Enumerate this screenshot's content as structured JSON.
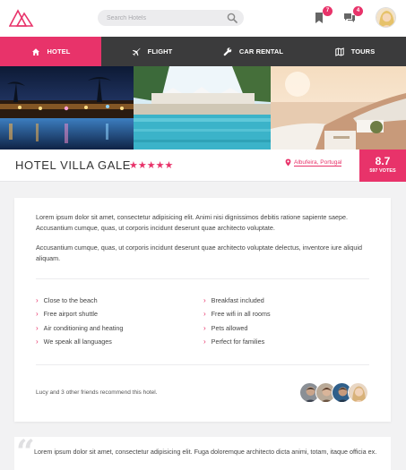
{
  "header": {
    "search_placeholder": "Search Hotels",
    "bookmarks_count": "7",
    "messages_count": "4"
  },
  "nav": {
    "tabs": [
      {
        "label": "HOTEL",
        "icon": "home-icon",
        "active": true
      },
      {
        "label": "FLIGHT",
        "icon": "airplane-icon",
        "active": false
      },
      {
        "label": "CAR RENTAL",
        "icon": "wrench-icon",
        "active": false
      },
      {
        "label": "TOURS",
        "icon": "map-icon",
        "active": false
      }
    ]
  },
  "hotel": {
    "name": "HOTEL VILLA GALE",
    "stars": "★★★★★",
    "rating_stars": 5,
    "location": "Albufeira, Portugal",
    "score": "8.7",
    "votes": "597 VOTES"
  },
  "description": {
    "paragraph1": "Lorem ipsum dolor sit amet, consectetur adipisicing elit. Animi nisi dignissimos debitis ratione sapiente saepe. Accusantium cumque, quas, ut corporis incidunt deserunt quae architecto voluptate.",
    "paragraph2": "Accusantium cumque, quas, ut corporis incidunt deserunt quae architecto voluptate delectus, inventore iure aliquid aliquam."
  },
  "amenities": {
    "left": [
      "Close to the beach",
      "Free airport shuttle",
      "Air conditioning and heating",
      "We speak all languages"
    ],
    "right": [
      "Breakfast included",
      "Free wifi in all rooms",
      "Pets allowed",
      "Perfect for families"
    ]
  },
  "recommendation": {
    "text": "Lucy and 3 other friends recommend this hotel."
  },
  "review": {
    "quote_mark": "“",
    "text": "Lorem ipsum dolor sit amet, consectetur adipisicing elit. Fuga doloremque architecto dicta animi, totam, itaque officia ex."
  },
  "colors": {
    "accent": "#e8336a",
    "nav_bg": "#3b3b3c",
    "page_bg": "#f2f2f3"
  }
}
